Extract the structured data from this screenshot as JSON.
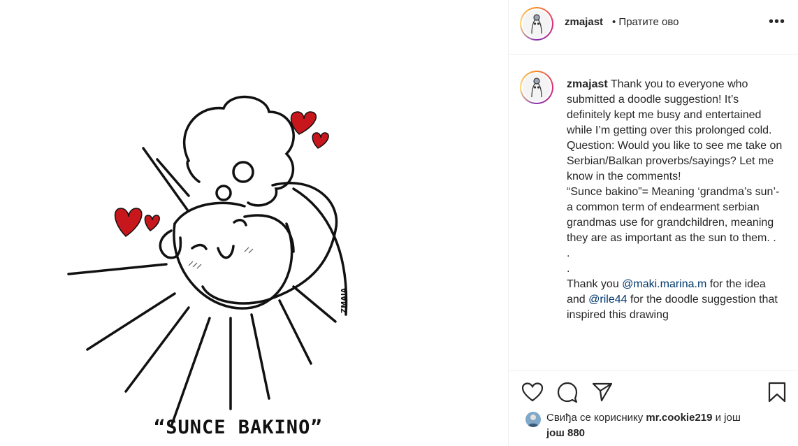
{
  "post": {
    "art_caption": "“SUNCE BAKINO”",
    "art_signature": "ZMAJA"
  },
  "header": {
    "username": "zmajast",
    "follow_label": "• Пратите ово",
    "more_icon": "more-options-icon"
  },
  "caption": {
    "username": "zmajast",
    "text_before_mention1": " Thank you to everyone who submitted a doodle suggestion! It’s definitely kept me busy and entertained while I’m getting over this prolonged cold.\nQuestion: Would you like to see me take on Serbian/Balkan proverbs/sayings? Let me know in the comments!\n“Sunce bakino”= Meaning ‘grandma’s sun’-a common term of endearment serbian grandmas use for grandchildren, meaning they are as important as the sun to them. .\n.\n.\nThank you ",
    "mention1": "@maki.marina.m",
    "text_between": " for the idea and ",
    "mention2": "@rile44",
    "text_after": " for the doodle suggestion that inspired this drawing"
  },
  "actions": {
    "like_icon": "heart-icon",
    "comment_icon": "comment-icon",
    "share_icon": "share-icon",
    "save_icon": "bookmark-icon"
  },
  "likes": {
    "prefix": "Свиђа се кориснику ",
    "user": "mr.cookie219",
    "suffix": " и још",
    "count_line": "још 880"
  }
}
